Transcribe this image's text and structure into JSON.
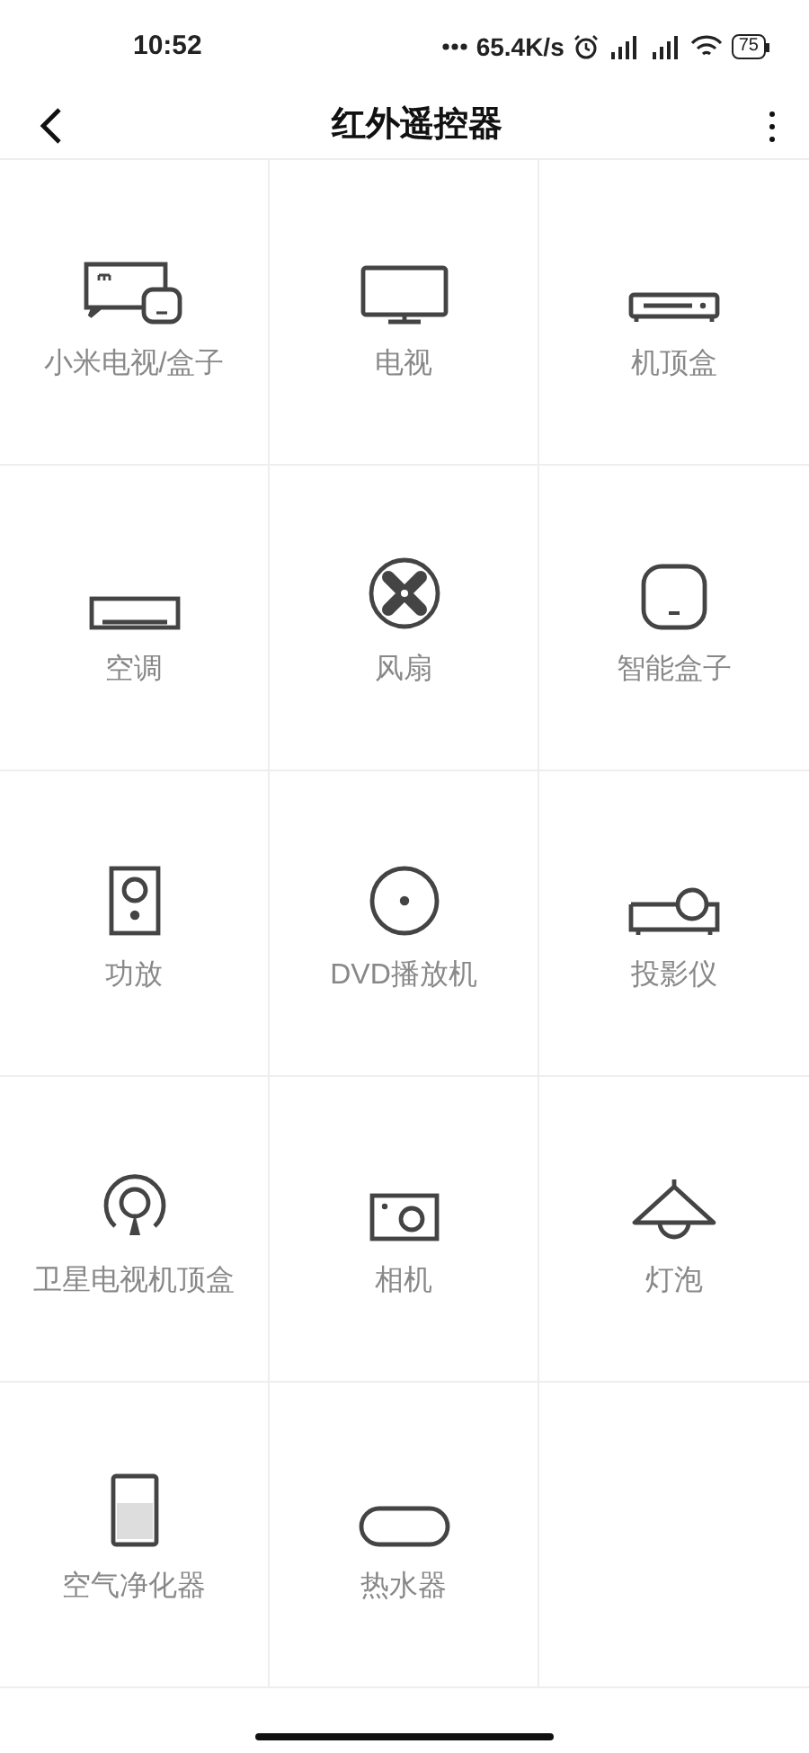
{
  "status_bar": {
    "time": "10:52",
    "network_speed": "65.4K/s",
    "battery": "75"
  },
  "header": {
    "title": "红外遥控器"
  },
  "devices": [
    {
      "kind": "mitv",
      "label": "小米电视/盒子"
    },
    {
      "kind": "tv",
      "label": "电视"
    },
    {
      "kind": "settop",
      "label": "机顶盒"
    },
    {
      "kind": "ac",
      "label": "空调"
    },
    {
      "kind": "fan",
      "label": "风扇"
    },
    {
      "kind": "smartbox",
      "label": "智能盒子"
    },
    {
      "kind": "amp",
      "label": "功放"
    },
    {
      "kind": "dvd",
      "label": "DVD播放机"
    },
    {
      "kind": "projector",
      "label": "投影仪"
    },
    {
      "kind": "satellite",
      "label": "卫星电视机顶盒"
    },
    {
      "kind": "camera",
      "label": "相机"
    },
    {
      "kind": "lamp",
      "label": "灯泡"
    },
    {
      "kind": "purifier",
      "label": "空气净化器"
    },
    {
      "kind": "heater",
      "label": "热水器"
    }
  ]
}
